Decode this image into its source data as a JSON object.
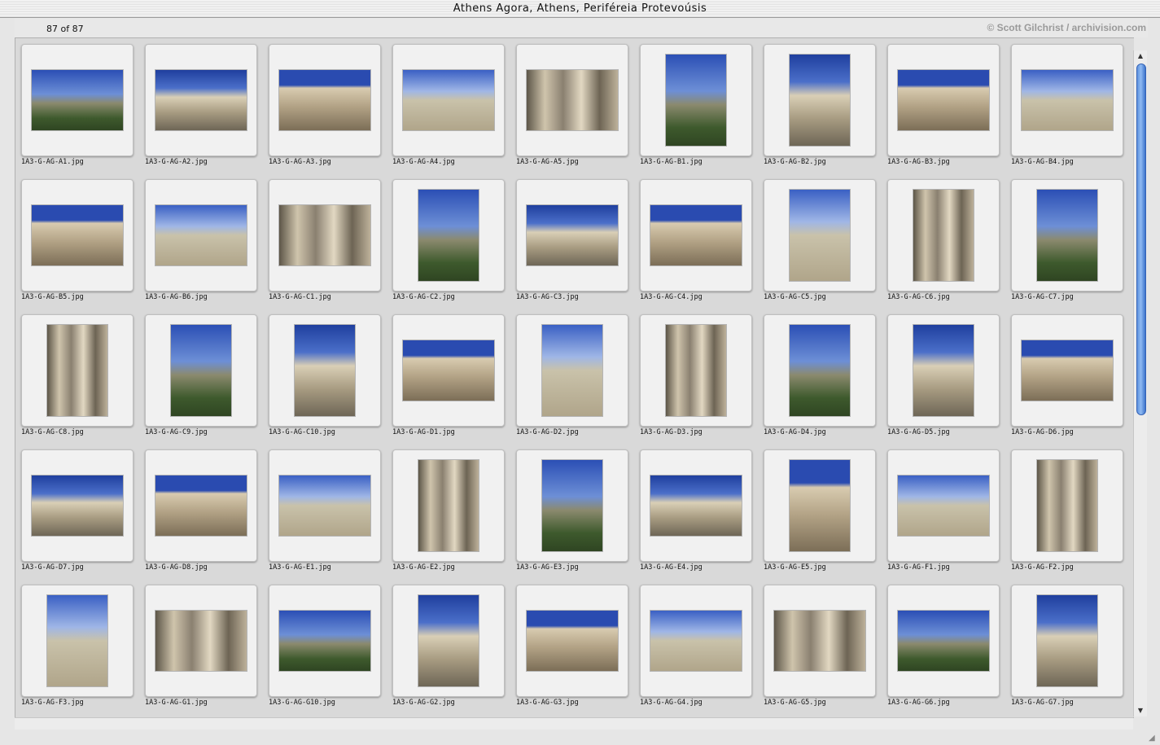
{
  "window": {
    "title": "Athens Agora, Athens, Periféreia Protevoúsis"
  },
  "header": {
    "counter": "87 of 87",
    "credit": "© Scott Gilchrist / archivision.com"
  },
  "colors": {
    "sky": "#2a4fb8",
    "stone": "#b9ab90",
    "foliage": "#3d5a2c",
    "scroll_thumb": "#5f93e0"
  },
  "thumbnails": [
    {
      "filename": "1A3-G-AG-A1.jpg",
      "orientation": "landscape"
    },
    {
      "filename": "1A3-G-AG-A2.jpg",
      "orientation": "landscape"
    },
    {
      "filename": "1A3-G-AG-A3.jpg",
      "orientation": "landscape"
    },
    {
      "filename": "1A3-G-AG-A4.jpg",
      "orientation": "landscape"
    },
    {
      "filename": "1A3-G-AG-A5.jpg",
      "orientation": "landscape"
    },
    {
      "filename": "1A3-G-AG-B1.jpg",
      "orientation": "portrait"
    },
    {
      "filename": "1A3-G-AG-B2.jpg",
      "orientation": "portrait"
    },
    {
      "filename": "1A3-G-AG-B3.jpg",
      "orientation": "landscape"
    },
    {
      "filename": "1A3-G-AG-B4.jpg",
      "orientation": "landscape"
    },
    {
      "filename": "1A3-G-AG-B5.jpg",
      "orientation": "landscape"
    },
    {
      "filename": "1A3-G-AG-B6.jpg",
      "orientation": "landscape"
    },
    {
      "filename": "1A3-G-AG-C1.jpg",
      "orientation": "landscape"
    },
    {
      "filename": "1A3-G-AG-C2.jpg",
      "orientation": "portrait"
    },
    {
      "filename": "1A3-G-AG-C3.jpg",
      "orientation": "landscape"
    },
    {
      "filename": "1A3-G-AG-C4.jpg",
      "orientation": "landscape"
    },
    {
      "filename": "1A3-G-AG-C5.jpg",
      "orientation": "portrait"
    },
    {
      "filename": "1A3-G-AG-C6.jpg",
      "orientation": "portrait"
    },
    {
      "filename": "1A3-G-AG-C7.jpg",
      "orientation": "portrait"
    },
    {
      "filename": "1A3-G-AG-C8.jpg",
      "orientation": "portrait"
    },
    {
      "filename": "1A3-G-AG-C9.jpg",
      "orientation": "portrait"
    },
    {
      "filename": "1A3-G-AG-C10.jpg",
      "orientation": "portrait"
    },
    {
      "filename": "1A3-G-AG-D1.jpg",
      "orientation": "landscape"
    },
    {
      "filename": "1A3-G-AG-D2.jpg",
      "orientation": "portrait"
    },
    {
      "filename": "1A3-G-AG-D3.jpg",
      "orientation": "portrait"
    },
    {
      "filename": "1A3-G-AG-D4.jpg",
      "orientation": "portrait"
    },
    {
      "filename": "1A3-G-AG-D5.jpg",
      "orientation": "portrait"
    },
    {
      "filename": "1A3-G-AG-D6.jpg",
      "orientation": "landscape"
    },
    {
      "filename": "1A3-G-AG-D7.jpg",
      "orientation": "landscape"
    },
    {
      "filename": "1A3-G-AG-D8.jpg",
      "orientation": "landscape"
    },
    {
      "filename": "1A3-G-AG-E1.jpg",
      "orientation": "landscape"
    },
    {
      "filename": "1A3-G-AG-E2.jpg",
      "orientation": "portrait"
    },
    {
      "filename": "1A3-G-AG-E3.jpg",
      "orientation": "portrait"
    },
    {
      "filename": "1A3-G-AG-E4.jpg",
      "orientation": "landscape"
    },
    {
      "filename": "1A3-G-AG-E5.jpg",
      "orientation": "portrait"
    },
    {
      "filename": "1A3-G-AG-F1.jpg",
      "orientation": "landscape"
    },
    {
      "filename": "1A3-G-AG-F2.jpg",
      "orientation": "portrait"
    },
    {
      "filename": "1A3-G-AG-F3.jpg",
      "orientation": "portrait"
    },
    {
      "filename": "1A3-G-AG-G1.jpg",
      "orientation": "landscape"
    },
    {
      "filename": "1A3-G-AG-G10.jpg",
      "orientation": "landscape"
    },
    {
      "filename": "1A3-G-AG-G2.jpg",
      "orientation": "portrait"
    },
    {
      "filename": "1A3-G-AG-G3.jpg",
      "orientation": "landscape"
    },
    {
      "filename": "1A3-G-AG-G4.jpg",
      "orientation": "landscape"
    },
    {
      "filename": "1A3-G-AG-G5.jpg",
      "orientation": "landscape"
    },
    {
      "filename": "1A3-G-AG-G6.jpg",
      "orientation": "landscape"
    },
    {
      "filename": "1A3-G-AG-G7.jpg",
      "orientation": "portrait"
    }
  ],
  "scrollbar": {
    "up_icon": "arrow-up-icon",
    "down_icon": "arrow-down-icon"
  }
}
